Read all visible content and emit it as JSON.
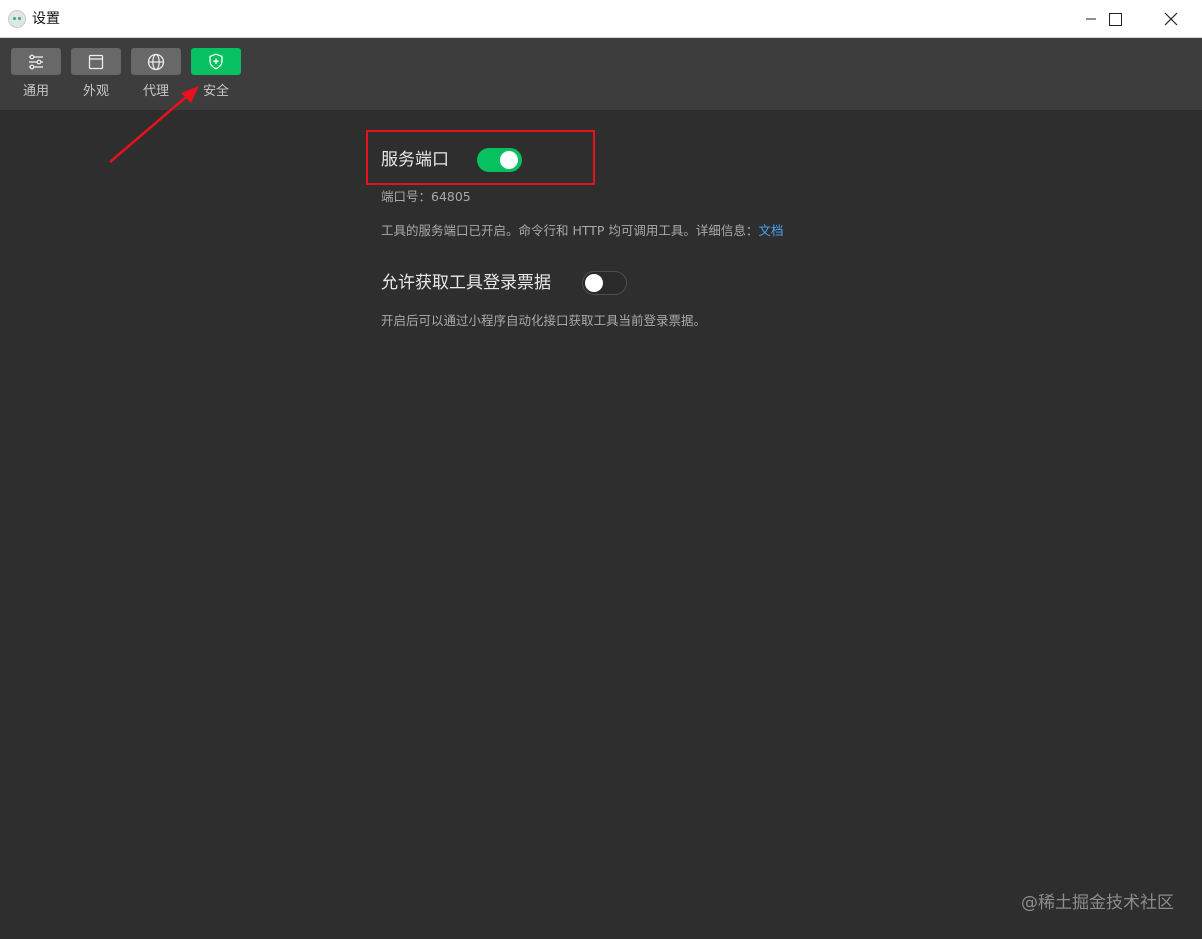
{
  "window": {
    "title": "设置",
    "controls": {
      "minimize": "minimize-icon",
      "maximize": "maximize-icon",
      "close": "close-icon"
    }
  },
  "toolbar": {
    "items": [
      {
        "label": "通用",
        "icon": "sliders-icon",
        "active": false
      },
      {
        "label": "外观",
        "icon": "window-icon",
        "active": false
      },
      {
        "label": "代理",
        "icon": "globe-icon",
        "active": false
      },
      {
        "label": "安全",
        "icon": "shield-icon",
        "active": true
      }
    ]
  },
  "settings": {
    "service_port": {
      "title": "服务端口",
      "enabled": true,
      "port_line": "端口号：64805",
      "description": "工具的服务端口已开启。命令行和 HTTP 均可调用工具。详细信息：",
      "link": "文档"
    },
    "login_ticket": {
      "title": "允许获取工具登录票据",
      "enabled": false,
      "description": "开启后可以通过小程序自动化接口获取工具当前登录票据。"
    }
  },
  "colors": {
    "accent": "#07c160",
    "annotation": "#e8121c",
    "link": "#4aa3f5"
  },
  "watermark": "@稀土掘金技术社区"
}
